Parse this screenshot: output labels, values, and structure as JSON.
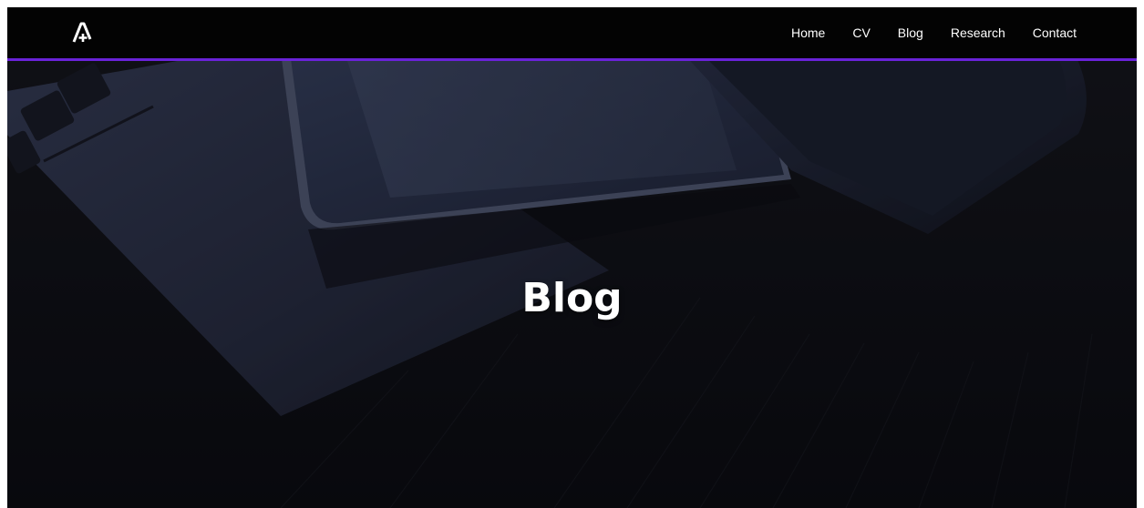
{
  "nav": {
    "logo_icon": "a-plus-logo-icon",
    "links": [
      {
        "label": "Home"
      },
      {
        "label": "CV"
      },
      {
        "label": "Blog"
      },
      {
        "label": "Research"
      },
      {
        "label": "Contact"
      }
    ]
  },
  "hero": {
    "title": "Blog",
    "background_description_icon": "laptop-tablet-desk-photo"
  },
  "colors": {
    "navbar_bg": "#030303",
    "accent_border": "#6a22d9",
    "hero_overlay": "#0c0d14",
    "text": "#ffffff"
  }
}
